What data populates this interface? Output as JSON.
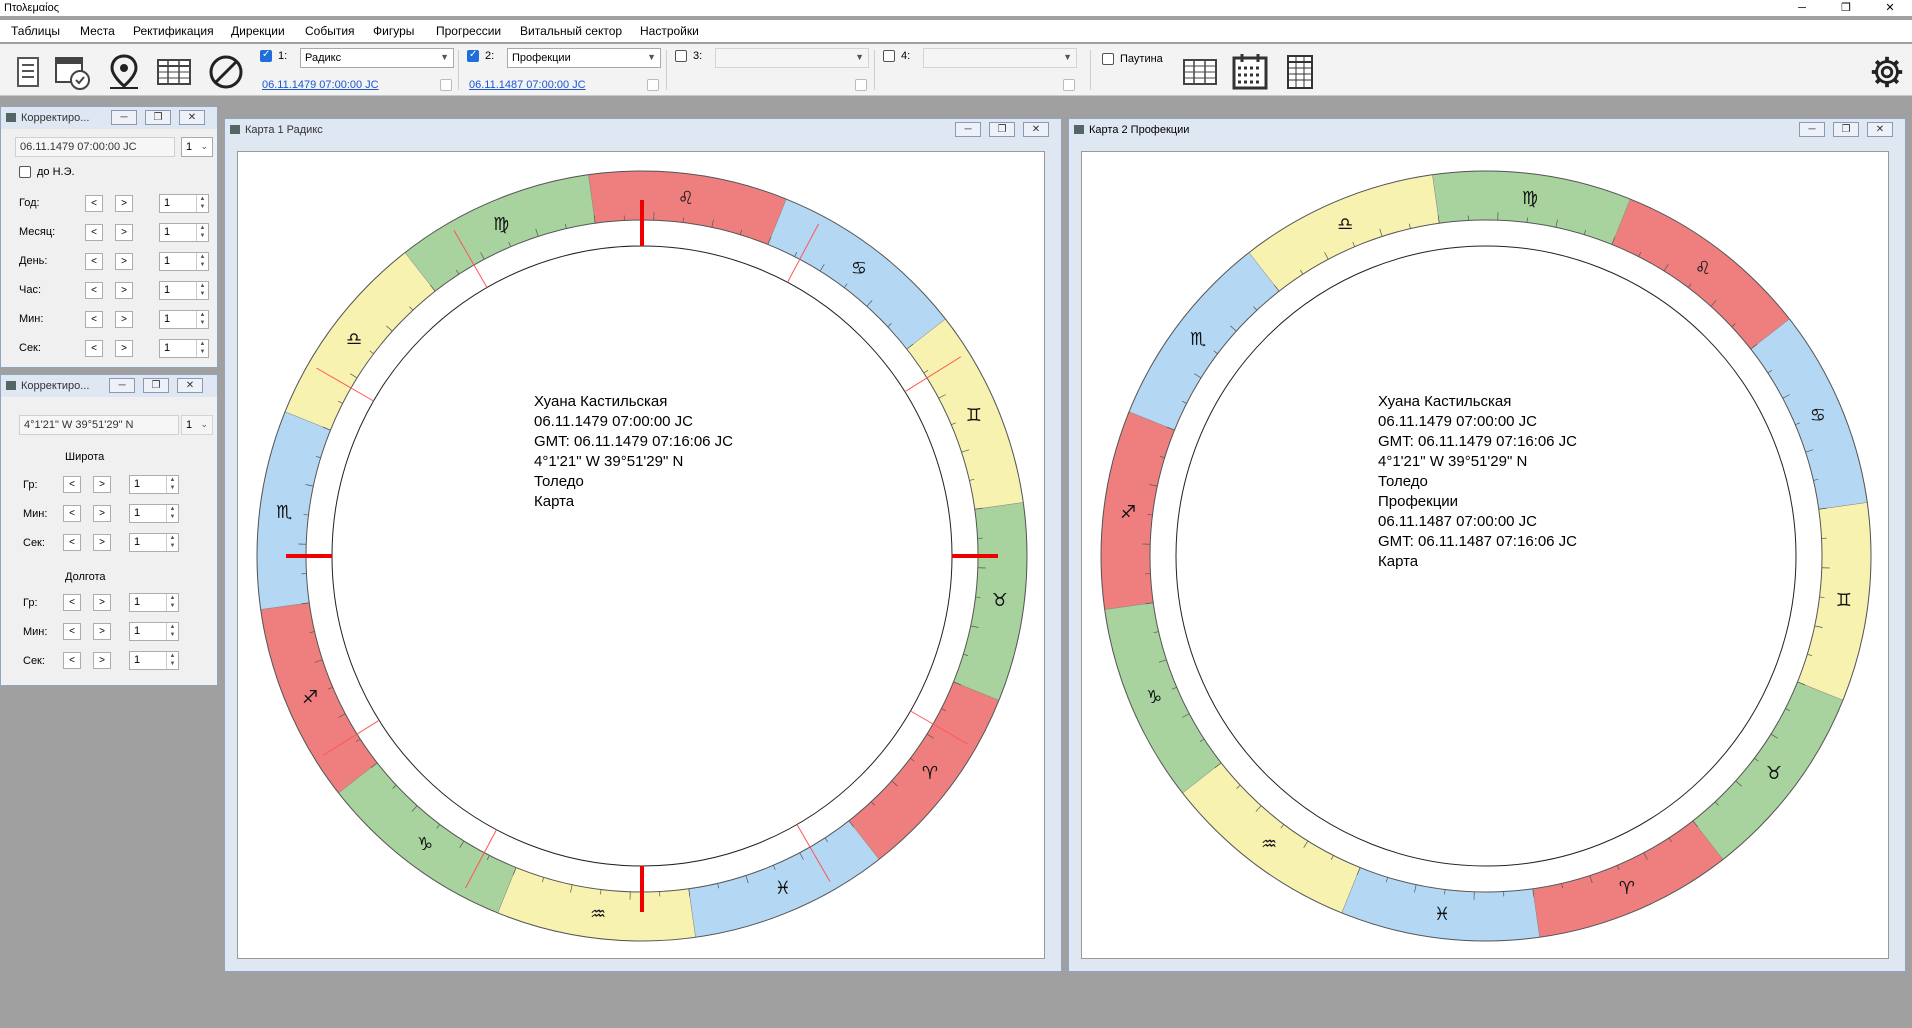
{
  "app": {
    "title": "Πτολεμαίος",
    "ctl_min": "─",
    "ctl_max": "❐",
    "ctl_close": "✕"
  },
  "menu": [
    "Таблицы",
    "Места",
    "Ректификация",
    "Дирекции",
    "События",
    "Фигуры",
    "Прогрессии",
    "Витальный сектор",
    "Настройки"
  ],
  "toolbar": {
    "slot1": {
      "label": "1:",
      "checked": true,
      "combo": "Радикс",
      "date": "06.11.1479 07:00:00 JC"
    },
    "slot2": {
      "label": "2:",
      "checked": true,
      "combo": "Профекции",
      "date": "06.11.1487 07:00:00 JC"
    },
    "slot3": {
      "label": "3:",
      "checked": false,
      "combo": ""
    },
    "slot4": {
      "label": "4:",
      "checked": false,
      "combo": ""
    },
    "web_label": "Паутина"
  },
  "date_panel": {
    "title": "Корректиро...",
    "date": "06.11.1479 07:00:00 JC",
    "step": "1",
    "bc_label": "до Н.Э.",
    "rows": [
      {
        "label": "Год:",
        "value": "1"
      },
      {
        "label": "Месяц:",
        "value": "1"
      },
      {
        "label": "День:",
        "value": "1"
      },
      {
        "label": "Час:",
        "value": "1"
      },
      {
        "label": "Мин:",
        "value": "1"
      },
      {
        "label": "Сек:",
        "value": "1"
      }
    ]
  },
  "coord_panel": {
    "title": "Корректиро...",
    "coords": "4°1'21\" W 39°51'29\" N",
    "step": "1",
    "lat_label": "Широта",
    "lon_label": "Долгота",
    "lat_rows": [
      {
        "label": "Гр:",
        "value": "1"
      },
      {
        "label": "Мин:",
        "value": "1"
      },
      {
        "label": "Сек:",
        "value": "1"
      }
    ],
    "lon_rows": [
      {
        "label": "Гр:",
        "value": "1"
      },
      {
        "label": "Мин:",
        "value": "1"
      },
      {
        "label": "Сек:",
        "value": "1"
      }
    ]
  },
  "nav_prev": "<",
  "nav_next": ">",
  "chart1": {
    "title": "Карта 1 Радикс",
    "info": [
      "Хуана Кастильская",
      "06.11.1479 07:00:00 JC",
      "GMT: 06.11.1479 07:16:06 JC",
      "4°1'21\" W 39°51'29\" N",
      "Толедо",
      "Карта"
    ]
  },
  "chart2": {
    "title": "Карта 2 Профекции",
    "info": [
      "Хуана Кастильская",
      "06.11.1479 07:00:00 JC",
      "GMT: 06.11.1479 07:16:06 JC",
      "4°1'21\" W 39°51'29\" N",
      "Толедо",
      "Профекции",
      "06.11.1487 07:00:00 JC",
      "GMT: 06.11.1487 07:16:06 JC",
      "Карта"
    ]
  },
  "colors": {
    "fire": "#ef7f7f",
    "earth": "#a8d39f",
    "air": "#f8f2b0",
    "water": "#b4d8f4"
  }
}
